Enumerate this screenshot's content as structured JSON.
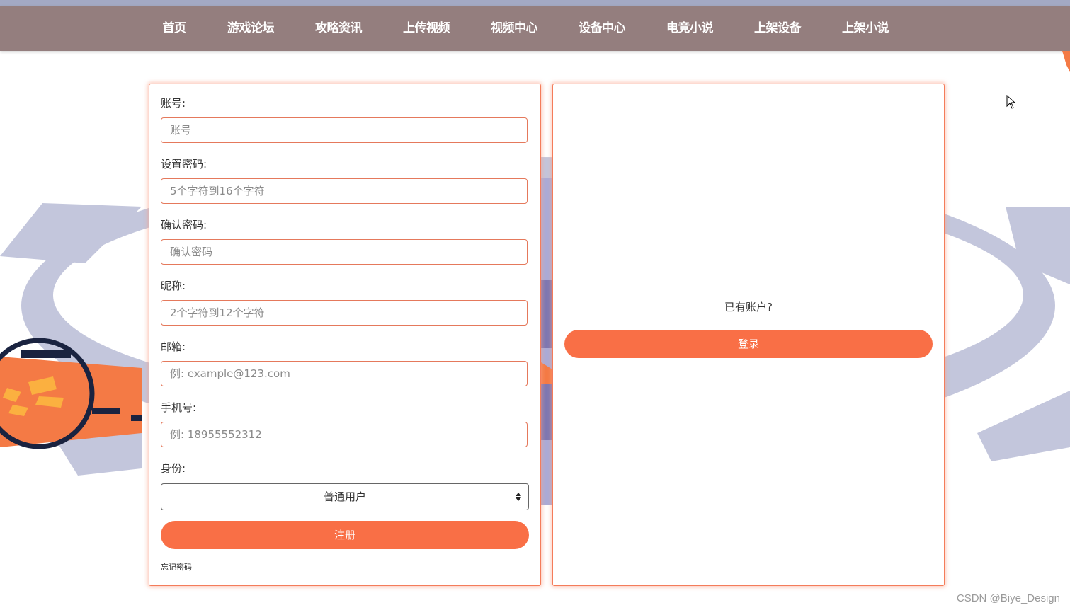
{
  "nav": {
    "items": [
      "首页",
      "游戏论坛",
      "攻略资讯",
      "上传视频",
      "视频中心",
      "设备中心",
      "电竞小说",
      "上架设备",
      "上架小说"
    ]
  },
  "register_form": {
    "account_label": "账号:",
    "account_placeholder": "账号",
    "password_label": "设置密码:",
    "password_placeholder": "5个字符到16个字符",
    "confirm_label": "确认密码:",
    "confirm_placeholder": "确认密码",
    "nickname_label": "昵称:",
    "nickname_placeholder": "2个字符到12个字符",
    "email_label": "邮箱:",
    "email_placeholder": "例: example@123.com",
    "phone_label": "手机号:",
    "phone_placeholder": "例: 18955552312",
    "role_label": "身份:",
    "role_selected": "普通用户",
    "register_button": "注册",
    "forgot_link": "忘记密码"
  },
  "login_panel": {
    "prompt": "已有账户?",
    "login_button": "登录"
  },
  "watermark": "CSDN @Biye_Design",
  "colors": {
    "navbar": "#947e7e",
    "accent": "#f96f46",
    "input_border": "#e5795c",
    "gear": "#c3c6dc"
  },
  "icons": [
    "gear-illustration",
    "gamepad-illustration",
    "select-arrows-icon",
    "mouse-cursor-icon"
  ]
}
